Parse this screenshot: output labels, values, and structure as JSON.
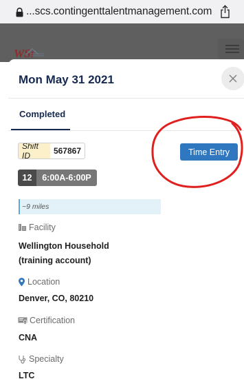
{
  "browser": {
    "url": "...scs.contingenttalentmanagement.com",
    "lock_icon": "lock-icon",
    "share_icon": "share-icon"
  },
  "app": {
    "logo_text": "WSi",
    "menu_icon": "hamburger-menu-icon"
  },
  "modal": {
    "title": "Mon May 31 2021",
    "close_icon": "close-icon",
    "tabs": [
      {
        "label": "Completed",
        "active": true
      }
    ],
    "shift": {
      "id_label": "Shift ID",
      "id_value": "567867",
      "hours": "12",
      "time_range": "6:00A-6:00P",
      "distance": "~9 miles"
    },
    "time_entry_label": "Time Entry",
    "details": {
      "facility_label": "Facility",
      "facility_value_line1": "Wellington Household",
      "facility_value_line2": "(training account)",
      "location_label": "Location",
      "location_value": "Denver, CO, 80210",
      "certification_label": "Certification",
      "certification_value": "CNA",
      "specialty_label": "Specialty",
      "specialty_value": "LTC"
    }
  },
  "colors": {
    "title_navy": "#16294e",
    "button_blue": "#2f78c0",
    "annotation_red": "#e0201e",
    "location_pin_blue": "#2f78c0",
    "shift_id_label_bg": "#fbf0c9",
    "distance_bg": "#e3f2f9"
  }
}
